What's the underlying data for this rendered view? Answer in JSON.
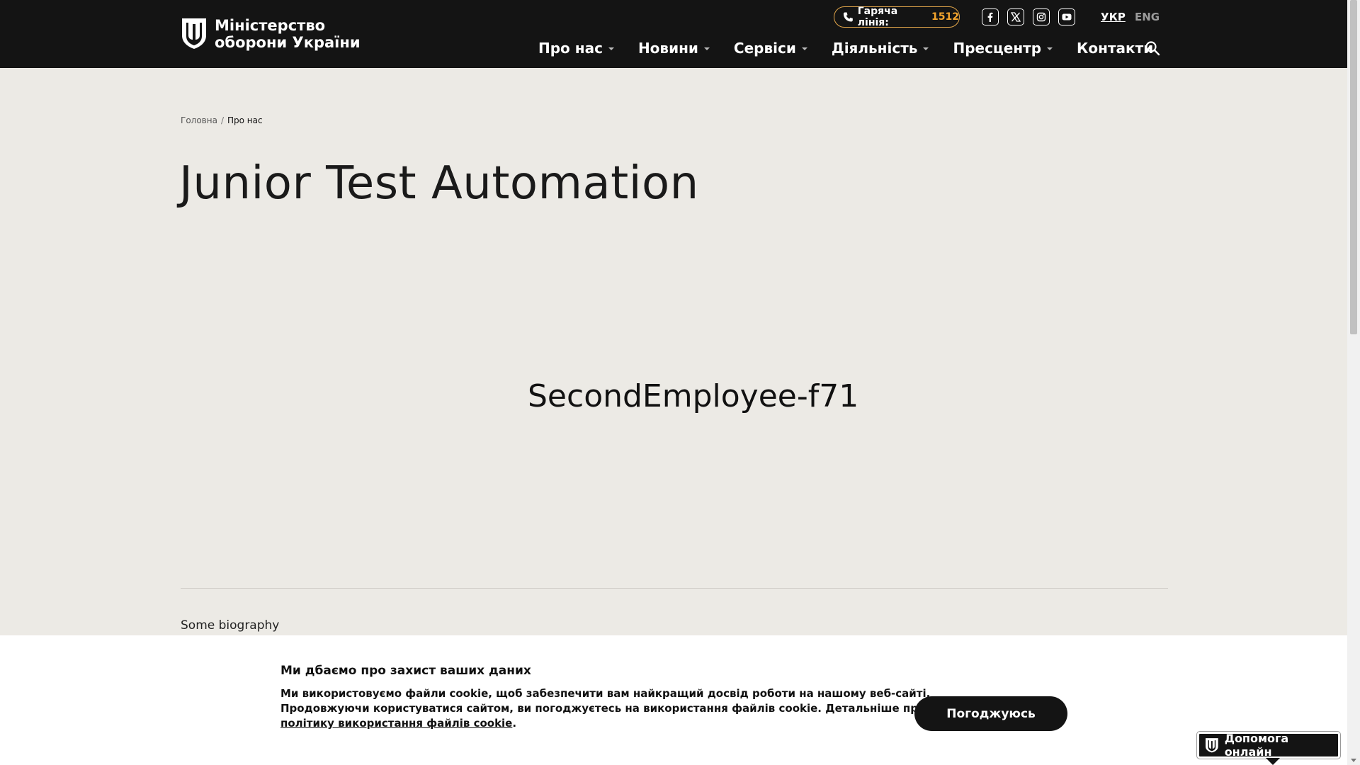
{
  "header": {
    "logo": {
      "line1": "Міністерство",
      "line2": "оборони України",
      "icon": "trident-shield-icon"
    },
    "hotline": {
      "label": "Гаряча лінія:",
      "number": "1512",
      "icon": "phone-icon",
      "accent": "#f4a52d"
    },
    "socials": [
      {
        "name": "facebook",
        "icon": "facebook-icon"
      },
      {
        "name": "x",
        "icon": "x-twitter-icon"
      },
      {
        "name": "instagram",
        "icon": "instagram-icon"
      },
      {
        "name": "youtube",
        "icon": "youtube-icon"
      }
    ],
    "languages": {
      "active": "УКР",
      "other": "ENG"
    },
    "nav": [
      {
        "label": "Про нас",
        "has_dropdown": true
      },
      {
        "label": "Новини",
        "has_dropdown": true
      },
      {
        "label": "Сервіси",
        "has_dropdown": true
      },
      {
        "label": "Діяльність",
        "has_dropdown": true
      },
      {
        "label": "Пресцентр",
        "has_dropdown": true
      },
      {
        "label": "Контакти",
        "has_dropdown": false
      }
    ],
    "search_icon": "search-icon"
  },
  "breadcrumb": {
    "home": "Головна",
    "separator": "/",
    "current": "Про нас"
  },
  "main": {
    "title": "Junior Test Automation",
    "employee_name": "SecondEmployee-f71",
    "bio": "Some biography"
  },
  "cookie": {
    "title": "Ми дбаємо про захист ваших даних",
    "line1": "Ми використовуємо файли cookie, щоб забезпечити вам найкращий досвід роботи на нашому веб-сайті.",
    "line2": "Продовжуючи користуватися сайтом, ви погоджуєтесь на використання файлів cookie. Детальніше про",
    "link": "політику використання файлів cookie",
    "link_suffix": ".",
    "accept_label": "Погоджуюсь"
  },
  "help_widget": {
    "label": "Допомога онлайн",
    "icon": "trident-shield-icon"
  },
  "colors": {
    "header_bg": "#141414",
    "page_bg": "#eceae5",
    "accent": "#f4a52d"
  }
}
